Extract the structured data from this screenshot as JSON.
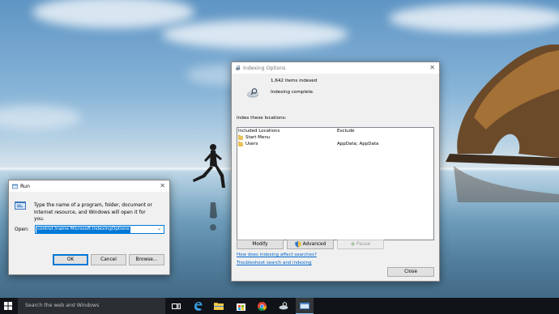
{
  "run_dialog": {
    "title": "Run",
    "description": "Type the name of a program, folder, document or Internet resource, and Windows will open it for you.",
    "open_label": "Open:",
    "command_value": "control /name Microsoft.IndexingOptions",
    "ok_label": "OK",
    "cancel_label": "Cancel",
    "browse_label": "Browse..."
  },
  "indexing_dialog": {
    "title": "Indexing Options",
    "items_indexed": "1,642 items indexed",
    "status": "Indexing complete.",
    "locations_label": "Index these locations:",
    "columns": {
      "included": "Included Locations",
      "exclude": "Exclude"
    },
    "locations": [
      {
        "name": "Start Menu",
        "exclude": ""
      },
      {
        "name": "Users",
        "exclude": "AppData; AppData"
      }
    ],
    "modify_label": "Modify",
    "advanced_label": "Advanced",
    "pause_label": "Pause",
    "link_help_indexing": "How does indexing affect searches?",
    "link_troubleshoot": "Troubleshoot search and indexing",
    "close_label": "Close"
  },
  "taskbar": {
    "search_placeholder": "Search the web and Windows",
    "icons": [
      "windows-start-icon",
      "task-view-icon",
      "edge-icon",
      "file-explorer-icon",
      "store-icon",
      "chrome-icon",
      "indexing-app-icon",
      "run-app-icon"
    ]
  },
  "colors": {
    "accent": "#0078d7",
    "taskbar": "#101418",
    "link": "#0066cc"
  }
}
